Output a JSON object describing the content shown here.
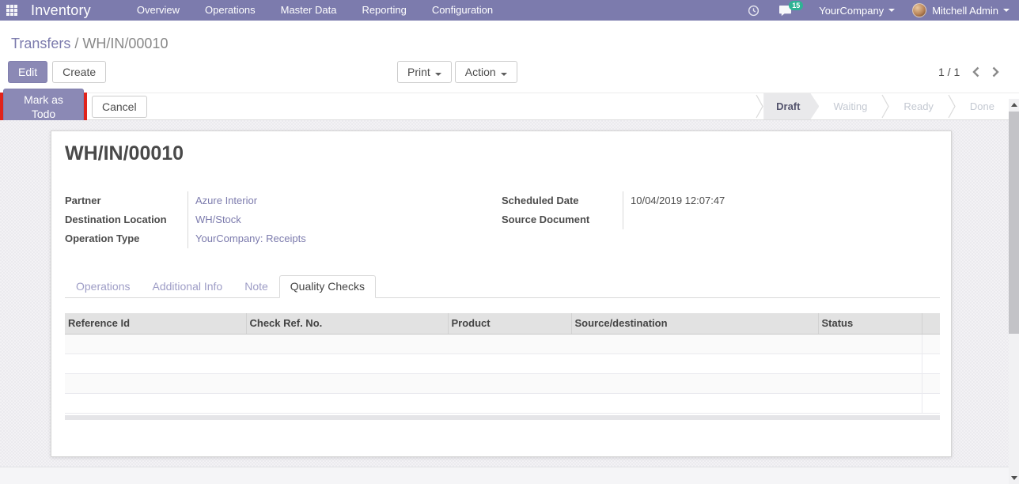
{
  "navbar": {
    "brand": "Inventory",
    "menus": [
      "Overview",
      "Operations",
      "Master Data",
      "Reporting",
      "Configuration"
    ],
    "systray": {
      "messages_badge": "15",
      "company": "YourCompany",
      "user": "Mitchell Admin"
    }
  },
  "breadcrumb": {
    "parent": "Transfers",
    "separator": "/",
    "current": "WH/IN/00010"
  },
  "control_panel": {
    "edit_label": "Edit",
    "create_label": "Create",
    "print_label": "Print",
    "action_label": "Action",
    "pager": "1 / 1"
  },
  "statusbar": {
    "mark_as_todo_label": "Mark as Todo",
    "cancel_label": "Cancel",
    "states": [
      "Draft",
      "Waiting",
      "Ready",
      "Done"
    ],
    "active_state": "Draft"
  },
  "sheet": {
    "title": "WH/IN/00010",
    "fields": {
      "partner_label": "Partner",
      "partner_value": "Azure Interior",
      "destination_label": "Destination Location",
      "destination_value": "WH/Stock",
      "operation_label": "Operation Type",
      "operation_value": "YourCompany: Receipts",
      "scheduled_label": "Scheduled Date",
      "scheduled_value": "10/04/2019 12:07:47",
      "source_label": "Source Document",
      "source_value": ""
    },
    "tabs": [
      "Operations",
      "Additional Info",
      "Note",
      "Quality Checks"
    ],
    "active_tab": "Quality Checks",
    "table": {
      "columns": [
        "Reference Id",
        "Check Ref. No.",
        "Product",
        "Source/destination",
        "Status"
      ],
      "rows": [],
      "empty_row_count": 4
    }
  },
  "colors": {
    "navbar_bg": "#7c7bad",
    "primary_button_bg": "#8b89b5",
    "link": "#7c7bad",
    "badge_bg": "#2eb394",
    "highlight_border": "#e0231c",
    "active_state_bg": "#e9e9eb"
  }
}
